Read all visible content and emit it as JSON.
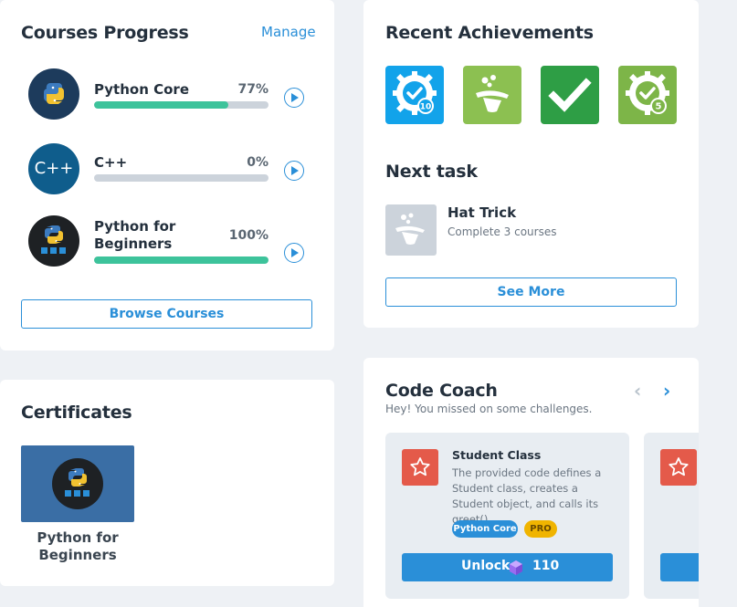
{
  "courses_card": {
    "title": "Courses Progress",
    "manage_label": "Manage",
    "courses": [
      {
        "title": "Python Core",
        "percent_label": "77%",
        "progress": 0.77
      },
      {
        "title": "C++",
        "percent_label": "0%",
        "progress": 0.0,
        "avatar_text": "C++"
      },
      {
        "title": "Python for Beginners",
        "percent_label": "100%",
        "progress": 1.0
      }
    ],
    "browse_label": "Browse Courses"
  },
  "certificates_card": {
    "title": "Certificates",
    "certificates": [
      {
        "title": "Python for Beginners"
      }
    ]
  },
  "achievements_card": {
    "title": "Recent Achievements",
    "badges": [
      {
        "icon": "gear-badge-10-icon",
        "color": "#12a3ea",
        "number": "10"
      },
      {
        "icon": "hat-trick-icon",
        "color": "#8cc051"
      },
      {
        "icon": "checkmark-icon",
        "color": "#2e9e45"
      },
      {
        "icon": "gear-badge-5-icon",
        "color": "#7db548",
        "number": "5"
      }
    ],
    "next_task_title": "Next task",
    "next_task": {
      "title": "Hat Trick",
      "description": "Complete 3 courses"
    },
    "see_more_label": "See More"
  },
  "code_coach": {
    "title": "Code Coach",
    "subtitle": "Hey! You missed on some challenges.",
    "challenge": {
      "title": "Student Class",
      "description": "The provided code defines a Student class, creates a Student object, and calls its greet()...",
      "tag": "Python Core",
      "pro_label": "PRO",
      "unlock_label": "Unlock",
      "cost": "110"
    }
  },
  "colors": {
    "accent": "#2a8fd8",
    "progress": "#3dc39b",
    "star_box": "#e45a4a",
    "pro_badge": "#f0b400"
  }
}
